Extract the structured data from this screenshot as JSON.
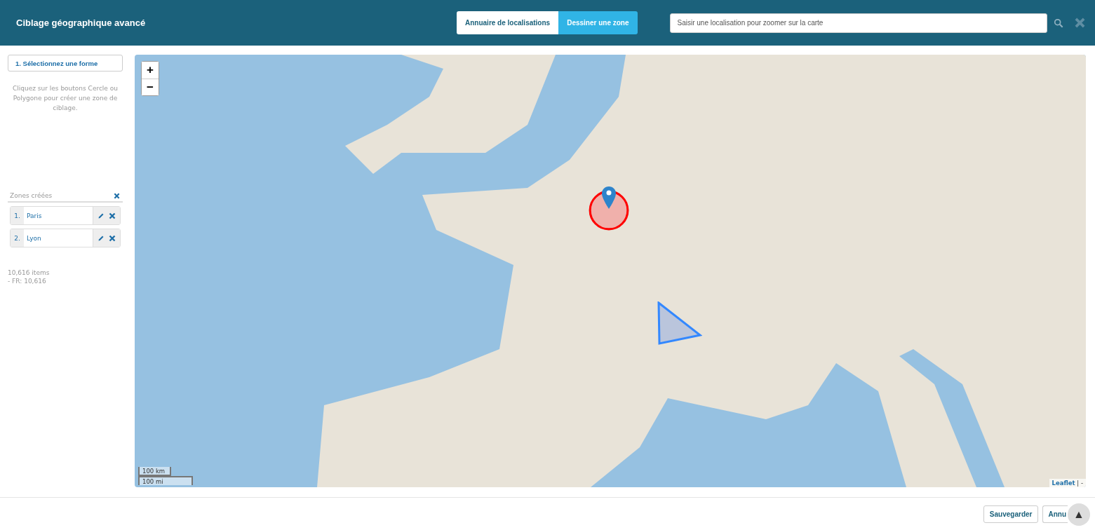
{
  "header": {
    "title": "Ciblage géographique avancé",
    "tabs": [
      {
        "label": "Annuaire de localisations",
        "selected": false
      },
      {
        "label": "Dessiner une zone",
        "selected": true
      }
    ],
    "search": {
      "placeholder": "Saisir une localisation pour zoomer sur la carte"
    }
  },
  "sidebar": {
    "step_button": "1. Sélectionnez une forme",
    "hint": "Cliquez sur les boutons Cercle ou Polygone pour créer une zone de ciblage.",
    "zones_title": "Zones créées",
    "zones": [
      {
        "number": "1.",
        "name": "Paris",
        "kind": "circle"
      },
      {
        "number": "2.",
        "name": "Lyon",
        "kind": "polygon"
      }
    ],
    "summary": [
      "10,616 items",
      "- FR: 10,616"
    ]
  },
  "map": {
    "zoom_in": "+",
    "zoom_out": "−",
    "scale": [
      "100 km",
      "100 mi"
    ],
    "attribution": "Leaflet",
    "attribution_suffix": "| -"
  },
  "footer": {
    "buttons": [
      "Sauvegarder",
      "Annu"
    ],
    "scroll_top": "▲"
  }
}
